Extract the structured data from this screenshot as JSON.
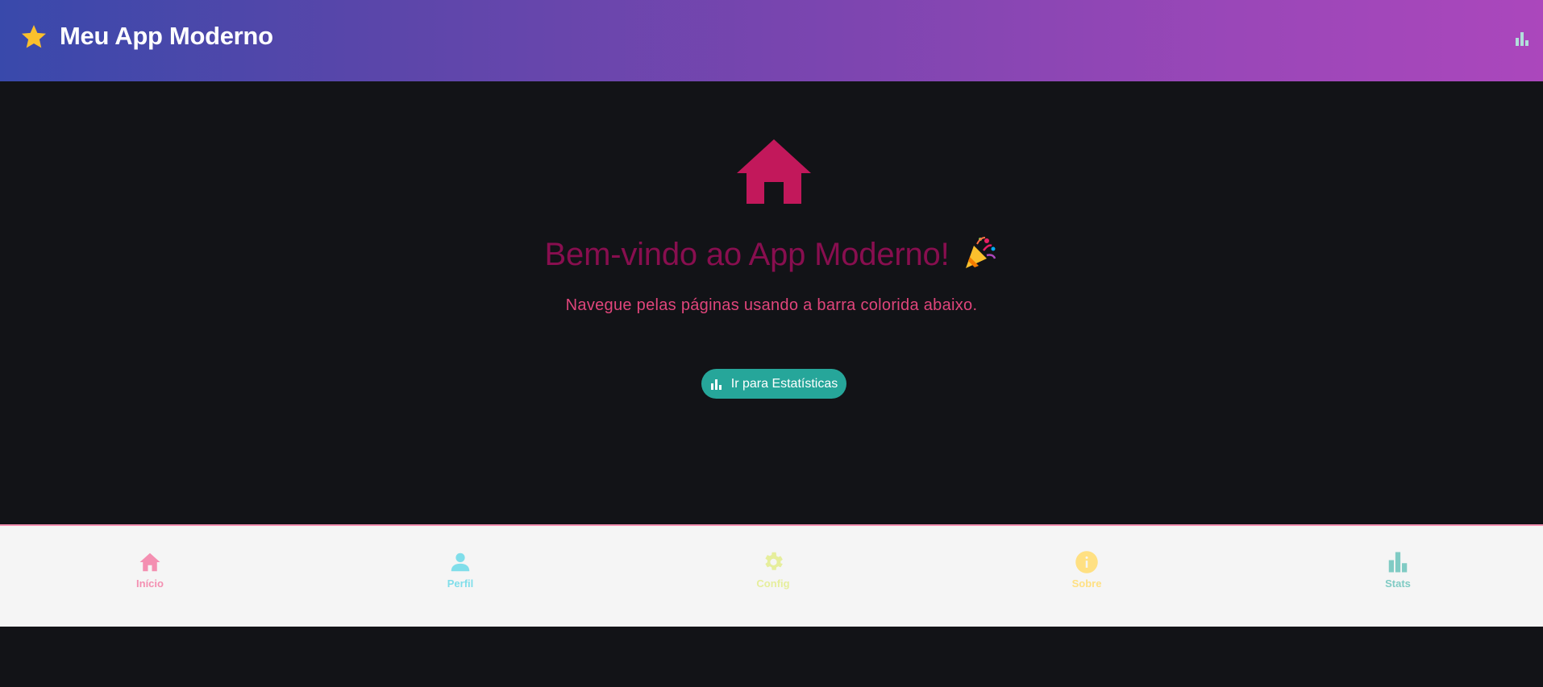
{
  "appbar": {
    "title": "Meu App Moderno",
    "leading_icon": "star-icon",
    "action_icon": "bar-chart-icon",
    "gradient": [
      "#3949ab",
      "#ab47bc"
    ]
  },
  "main": {
    "hero_icon": "home-icon",
    "headline": "Bem-vindo ao App Moderno!",
    "headline_emoji": "party-popper-icon",
    "subtitle": "Navegue pelas páginas usando a barra colorida abaixo.",
    "cta_label": "Ir para Estatísticas",
    "cta_icon": "bar-chart-icon"
  },
  "bottom_nav": {
    "items": [
      {
        "label": "Início",
        "icon": "home-icon",
        "color": "#f48fb1",
        "active": true
      },
      {
        "label": "Perfil",
        "icon": "person-icon",
        "color": "#80deea"
      },
      {
        "label": "Config",
        "icon": "gear-icon",
        "color": "#e6ee9c"
      },
      {
        "label": "Sobre",
        "icon": "info-icon",
        "color": "#ffe082"
      },
      {
        "label": "Stats",
        "icon": "bar-chart-icon",
        "color": "#80cbc4"
      }
    ]
  },
  "colors": {
    "background": "#121317",
    "headline": "#880e4f",
    "subtitle": "#e0457b",
    "hero_icon": "#c2185b",
    "cta": "#26a69a",
    "nav_bg": "#f5f5f5"
  }
}
